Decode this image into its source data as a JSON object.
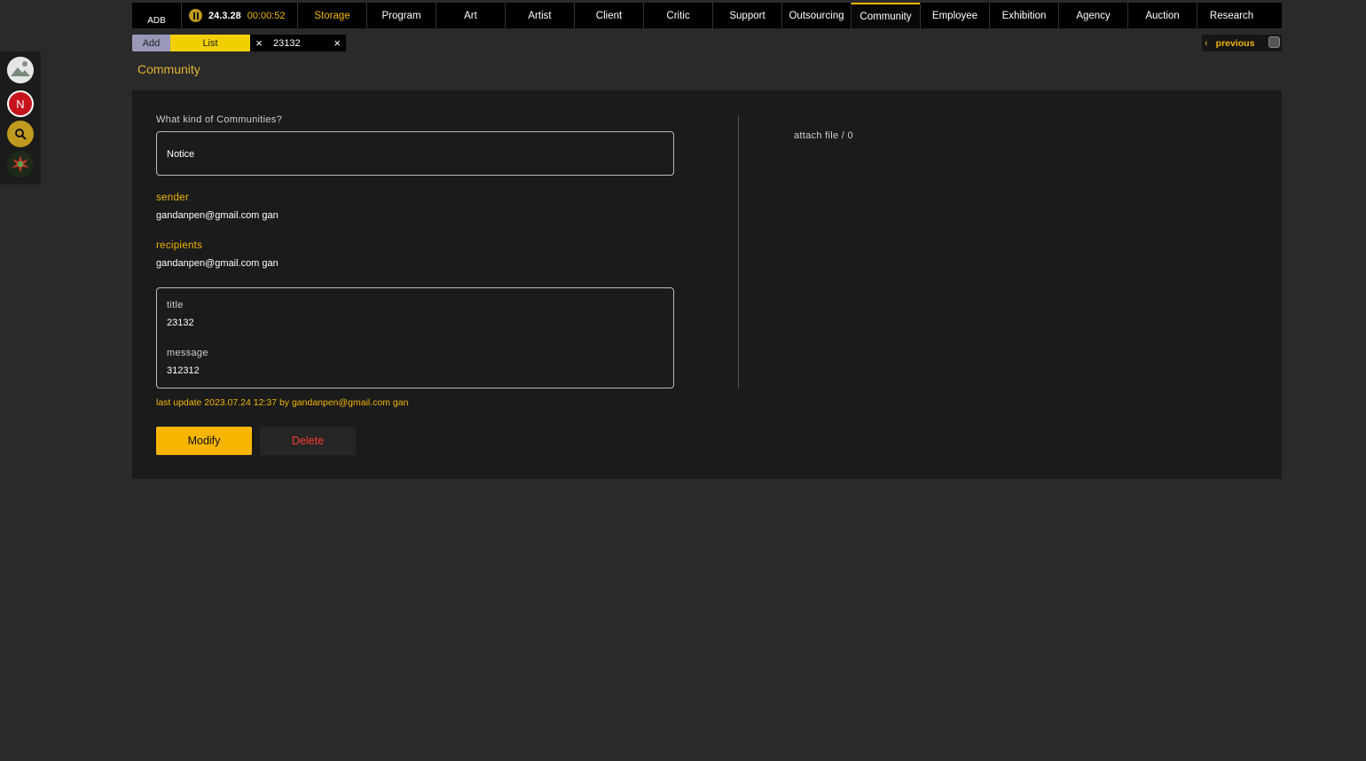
{
  "dock": {
    "items": [
      "avatar",
      "N",
      "search-icon",
      "burst-icon"
    ],
    "n_badge": "N"
  },
  "brand": "ADB",
  "timer": {
    "date": "24.3.28",
    "time": "00:00:52"
  },
  "nav": {
    "tabs": [
      {
        "label": "Storage"
      },
      {
        "label": "Program"
      },
      {
        "label": "Art"
      },
      {
        "label": "Artist"
      },
      {
        "label": "Client"
      },
      {
        "label": "Critic"
      },
      {
        "label": "Support"
      },
      {
        "label": "Outsourcing"
      },
      {
        "label": "Community"
      },
      {
        "label": "Employee"
      },
      {
        "label": "Exhibition"
      },
      {
        "label": "Agency"
      },
      {
        "label": "Auction"
      },
      {
        "label": "Research"
      }
    ],
    "highlighted": "Storage",
    "active": "Community"
  },
  "subbar": {
    "add": "Add",
    "list": "List",
    "close_list": "×",
    "doc_tab": "23132",
    "close_doc": "×"
  },
  "pager": {
    "chevron": "‹",
    "previous": "previous"
  },
  "page": {
    "title": "Community"
  },
  "form": {
    "kind_label": "What kind of Communities?",
    "kind_value": "Notice",
    "sender_label": "sender",
    "sender_value": "gandanpen@gmail.com gan",
    "recipients_label": "recipients",
    "recipients_value": "gandanpen@gmail.com gan",
    "title_label": "title",
    "title_value": "23132",
    "message_label": "message",
    "message_value": "312312",
    "last_update": "last update 2023.07.24 12:37 by gandanpen@gmail.com gan",
    "attach": "attach file / 0"
  },
  "actions": {
    "modify": "Modify",
    "delete": "Delete"
  },
  "colors": {
    "accent": "#f2b705",
    "delete": "#ff3b2f",
    "background": "#2a2a2a",
    "panel": "#1b1b1b"
  }
}
